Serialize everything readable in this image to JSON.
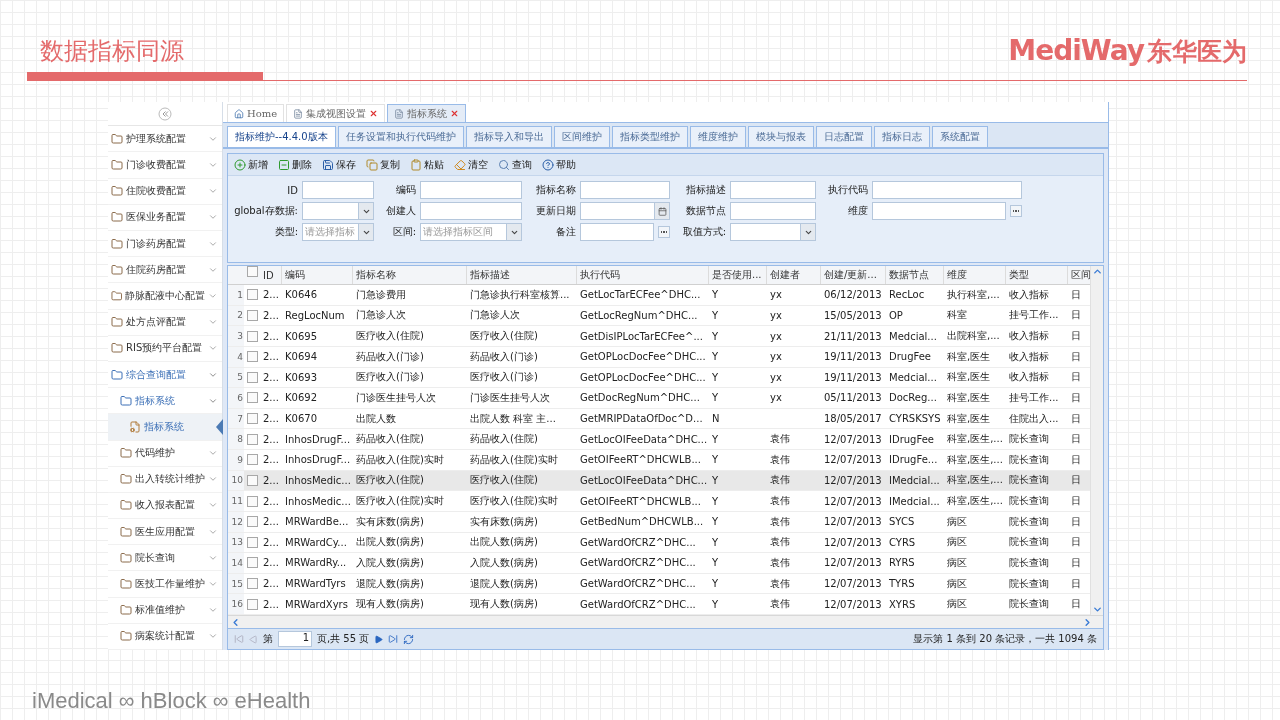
{
  "slide": {
    "title": "数据指标同源",
    "logo_latin": "MediWay",
    "logo_cjk": "东华医为",
    "footer": "iMedical ∞ hBlock ∞ eHealth"
  },
  "sidebar": {
    "items": [
      {
        "label": "护理系统配置",
        "kind": "group",
        "expanded": false,
        "selected": false
      },
      {
        "label": "门诊收费配置",
        "kind": "group",
        "expanded": false,
        "selected": false
      },
      {
        "label": "住院收费配置",
        "kind": "group",
        "expanded": false,
        "selected": false
      },
      {
        "label": "医保业务配置",
        "kind": "group",
        "expanded": false,
        "selected": false
      },
      {
        "label": "门诊药房配置",
        "kind": "group",
        "expanded": false,
        "selected": false
      },
      {
        "label": "住院药房配置",
        "kind": "group",
        "expanded": false,
        "selected": false
      },
      {
        "label": "静脉配液中心配置",
        "kind": "group",
        "expanded": false,
        "selected": false
      },
      {
        "label": "处方点评配置",
        "kind": "group",
        "expanded": false,
        "selected": false
      },
      {
        "label": "RIS预约平台配置",
        "kind": "group",
        "expanded": false,
        "selected": false
      },
      {
        "label": "综合查询配置",
        "kind": "group",
        "expanded": true,
        "selected": false,
        "children": [
          {
            "label": "指标系统",
            "kind": "group",
            "expanded": true,
            "selected": false,
            "children": [
              {
                "label": "指标系统",
                "kind": "page",
                "expanded": false,
                "selected": true
              }
            ]
          },
          {
            "label": "代码维护",
            "kind": "group",
            "expanded": false,
            "selected": false
          },
          {
            "label": "出入转统计维护",
            "kind": "group",
            "expanded": false,
            "selected": false
          },
          {
            "label": "收入报表配置",
            "kind": "group",
            "expanded": false,
            "selected": false
          },
          {
            "label": "医生应用配置",
            "kind": "group",
            "expanded": false,
            "selected": false
          },
          {
            "label": "院长查询",
            "kind": "group",
            "expanded": false,
            "selected": false
          },
          {
            "label": "医技工作量维护",
            "kind": "group",
            "expanded": false,
            "selected": false
          },
          {
            "label": "标准值维护",
            "kind": "group",
            "expanded": false,
            "selected": false
          },
          {
            "label": "病案统计配置",
            "kind": "group",
            "expanded": false,
            "selected": false
          }
        ]
      }
    ]
  },
  "page_tabs": [
    {
      "label": "Home",
      "kind": "home",
      "closable": false,
      "selected": false
    },
    {
      "label": "集成视图设置",
      "kind": "page",
      "closable": true,
      "selected": false
    },
    {
      "label": "指标系统",
      "kind": "page",
      "closable": true,
      "selected": true
    }
  ],
  "module_tabs": [
    {
      "label": "指标维护--4.4.0版本",
      "selected": true
    },
    {
      "label": "任务设置和执行代码维护",
      "selected": false
    },
    {
      "label": "指标导入和导出",
      "selected": false
    },
    {
      "label": "区间维护",
      "selected": false
    },
    {
      "label": "指标类型维护",
      "selected": false
    },
    {
      "label": "维度维护",
      "selected": false
    },
    {
      "label": "模块与报表",
      "selected": false
    },
    {
      "label": "日志配置",
      "selected": false
    },
    {
      "label": "指标日志",
      "selected": false
    },
    {
      "label": "系统配置",
      "selected": false
    }
  ],
  "toolbar": [
    {
      "label": "新增",
      "kind": "add"
    },
    {
      "label": "删除",
      "kind": "delete"
    },
    {
      "label": "保存",
      "kind": "save"
    },
    {
      "label": "复制",
      "kind": "copy"
    },
    {
      "label": "粘贴",
      "kind": "paste"
    },
    {
      "label": "清空",
      "kind": "clear"
    },
    {
      "label": "查询",
      "kind": "search"
    },
    {
      "label": "帮助",
      "kind": "help"
    }
  ],
  "form": {
    "rows": [
      [
        {
          "label": "ID",
          "kind": "text"
        },
        {
          "label": "编码",
          "kind": "text"
        },
        {
          "label": "指标名称",
          "kind": "text"
        },
        {
          "label": "指标描述",
          "kind": "text"
        },
        {
          "label": "执行代码",
          "kind": "text"
        }
      ],
      [
        {
          "label": "global存数据:",
          "kind": "select"
        },
        {
          "label": "创建人",
          "kind": "text"
        },
        {
          "label": "更新日期",
          "kind": "date"
        },
        {
          "label": "数据节点",
          "kind": "text"
        },
        {
          "label": "维度",
          "kind": "lookup"
        }
      ],
      [
        {
          "label": "类型:",
          "kind": "select",
          "placeholder": "请选择指标"
        },
        {
          "label": "区间:",
          "kind": "select",
          "placeholder": "请选择指标区间"
        },
        {
          "label": "备注",
          "kind": "lookup"
        },
        {
          "label": "取值方式:",
          "kind": "select"
        }
      ]
    ]
  },
  "table": {
    "all_checked": false,
    "columns": [
      "ID",
      "编码",
      "指标名称",
      "指标描述",
      "执行代码",
      "是否使用...",
      "创建者",
      "创建/更新...",
      "数据节点",
      "维度",
      "类型",
      "区间"
    ],
    "rows": [
      {
        "number": "1",
        "selected": false,
        "checked": false,
        "cells": [
          "2...",
          "K0646",
          "门急诊费用",
          "门急诊执行科室核算...",
          "GetLocTarECFee^DHC...",
          "Y",
          "yx",
          "06/12/2013",
          "RecLoc",
          "执行科室,...",
          "收入指标",
          "日"
        ]
      },
      {
        "number": "2",
        "selected": false,
        "checked": false,
        "cells": [
          "2...",
          "RegLocNum",
          "门急诊人次",
          "门急诊人次",
          "GetLocRegNum^DHC...",
          "Y",
          "yx",
          "15/05/2013",
          "OP",
          "科室",
          "挂号工作...",
          "日"
        ]
      },
      {
        "number": "3",
        "selected": false,
        "checked": false,
        "cells": [
          "2...",
          "K0695",
          "医疗收入(住院)",
          "医疗收入(住院)",
          "GetDisIPLocTarECFee^...",
          "Y",
          "yx",
          "21/11/2013",
          "Medcial...",
          "出院科室,...",
          "收入指标",
          "日"
        ]
      },
      {
        "number": "4",
        "selected": false,
        "checked": false,
        "cells": [
          "2...",
          "K0694",
          "药品收入(门诊)",
          "药品收入(门诊)",
          "GetOPLocDocFee^DHC...",
          "Y",
          "yx",
          "19/11/2013",
          "DrugFee",
          "科室,医生",
          "收入指标",
          "日"
        ]
      },
      {
        "number": "5",
        "selected": false,
        "checked": false,
        "cells": [
          "2...",
          "K0693",
          "医疗收入(门诊)",
          "医疗收入(门诊)",
          "GetOPLocDocFee^DHC...",
          "Y",
          "yx",
          "19/11/2013",
          "Medcial...",
          "科室,医生",
          "收入指标",
          "日"
        ]
      },
      {
        "number": "6",
        "selected": false,
        "checked": false,
        "cells": [
          "2...",
          "K0692",
          "门诊医生挂号人次",
          "门诊医生挂号人次",
          "GetDocRegNum^DHC...",
          "Y",
          "yx",
          "05/11/2013",
          "DocReg...",
          "科室,医生",
          "挂号工作...",
          "日"
        ]
      },
      {
        "number": "7",
        "selected": false,
        "checked": false,
        "cells": [
          "2...",
          "K0670",
          "出院人数",
          "出院人数  科室  主...",
          "GetMRIPDataOfDoc^D...",
          "N",
          null,
          "18/05/2017",
          "CYRSKSYS",
          "科室,医生",
          "住院出入...",
          "日"
        ]
      },
      {
        "number": "8",
        "selected": false,
        "checked": false,
        "cells": [
          "2...",
          "InhosDrugF...",
          "药品收入(住院)",
          "药品收入(住院)",
          "GetLocOIFeeData^DHC...",
          "Y",
          "袁伟",
          "12/07/2013",
          "IDrugFee",
          "科室,医生,...",
          "院长查询",
          "日"
        ]
      },
      {
        "number": "9",
        "selected": false,
        "checked": false,
        "cells": [
          "2...",
          "InhosDrugF...",
          "药品收入(住院)实时",
          "药品收入(住院)实时",
          "GetOIFeeRT^DHCWLB...",
          "Y",
          "袁伟",
          "12/07/2013",
          "IDrugFe...",
          "科室,医生,...",
          "院长查询",
          "日"
        ]
      },
      {
        "number": "10",
        "selected": true,
        "checked": false,
        "cells": [
          "2...",
          "InhosMedic...",
          "医疗收入(住院)",
          "医疗收入(住院)",
          "GetLocOIFeeData^DHC...",
          "Y",
          "袁伟",
          "12/07/2013",
          "IMedcial...",
          "科室,医生,...",
          "院长查询",
          "日"
        ]
      },
      {
        "number": "11",
        "selected": false,
        "checked": false,
        "cells": [
          "2...",
          "InhosMedic...",
          "医疗收入(住院)实时",
          "医疗收入(住院)实时",
          "GetOIFeeRT^DHCWLB...",
          "Y",
          "袁伟",
          "12/07/2013",
          "IMedcial...",
          "科室,医生,...",
          "院长查询",
          "日"
        ]
      },
      {
        "number": "12",
        "selected": false,
        "checked": false,
        "cells": [
          "2...",
          "MRWardBe...",
          "实有床数(病房)",
          "实有床数(病房)",
          "GetBedNum^DHCWLB...",
          "Y",
          "袁伟",
          "12/07/2013",
          "SYCS",
          "病区",
          "院长查询",
          "日"
        ]
      },
      {
        "number": "13",
        "selected": false,
        "checked": false,
        "cells": [
          "2...",
          "MRWardCy...",
          "出院人数(病房)",
          "出院人数(病房)",
          "GetWardOfCRZ^DHC...",
          "Y",
          "袁伟",
          "12/07/2013",
          "CYRS",
          "病区",
          "院长查询",
          "日"
        ]
      },
      {
        "number": "14",
        "selected": false,
        "checked": false,
        "cells": [
          "2...",
          "MRWardRy...",
          "入院人数(病房)",
          "入院人数(病房)",
          "GetWardOfCRZ^DHC...",
          "Y",
          "袁伟",
          "12/07/2013",
          "RYRS",
          "病区",
          "院长查询",
          "日"
        ]
      },
      {
        "number": "15",
        "selected": false,
        "checked": false,
        "cells": [
          "2...",
          "MRWardTyrs",
          "退院人数(病房)",
          "退院人数(病房)",
          "GetWardOfCRZ^DHC...",
          "Y",
          "袁伟",
          "12/07/2013",
          "TYRS",
          "病区",
          "院长查询",
          "日"
        ]
      },
      {
        "number": "16",
        "selected": false,
        "checked": false,
        "cells": [
          "2...",
          "MRWardXyrs",
          "现有人数(病房)",
          "现有人数(病房)",
          "GetWardOfCRZ^DHC...",
          "Y",
          "袁伟",
          "12/07/2013",
          "XYRS",
          "病区",
          "院长查询",
          "日"
        ]
      }
    ]
  },
  "pager": {
    "before": "第",
    "page": "1",
    "after": "页,共 55 页",
    "summary": "显示第 1 条到 20 条记录，一共 1094 条"
  }
}
